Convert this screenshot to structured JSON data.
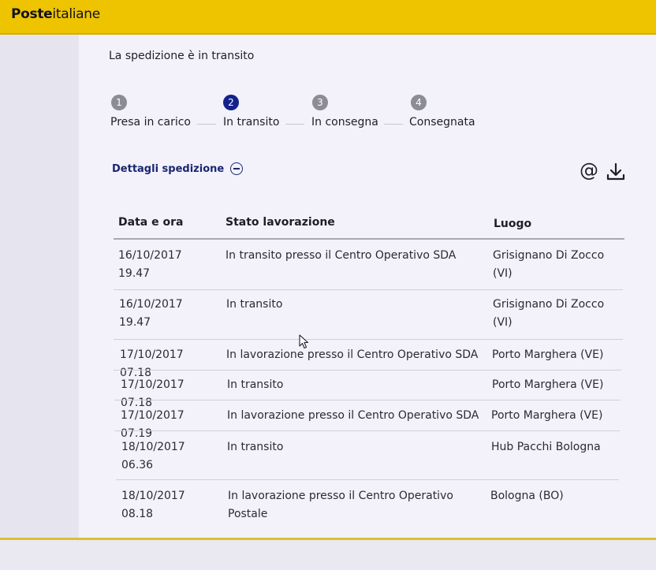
{
  "brand": {
    "bold": "Poste",
    "regular": "italiane"
  },
  "shipment": {
    "status_text": "La spedizione è in transito",
    "steps": [
      {
        "num": "1",
        "label": "Presa in carico",
        "active": false
      },
      {
        "num": "2",
        "label": "In transito",
        "active": true
      },
      {
        "num": "3",
        "label": "In consegna",
        "active": false
      },
      {
        "num": "4",
        "label": "Consegnata",
        "active": false
      }
    ],
    "details_label": "Dettagli spedizione"
  },
  "table": {
    "headers": {
      "date": "Data e ora",
      "status": "Stato lavorazione",
      "place": "Luogo"
    },
    "rows": [
      {
        "date": "16/10/2017 19.47",
        "status": "In transito presso il Centro Operativo SDA",
        "place": "Grisignano Di Zocco (VI)"
      },
      {
        "date": "16/10/2017 19.47",
        "status": "In transito",
        "place": "Grisignano Di Zocco (VI)"
      },
      {
        "date": "17/10/2017 07.18",
        "status": "In lavorazione presso il Centro Operativo SDA",
        "place": "Porto Marghera (VE)"
      },
      {
        "date": "17/10/2017 07.18",
        "status": "In transito",
        "place": "Porto Marghera (VE)"
      },
      {
        "date": "17/10/2017 07.19",
        "status": "In lavorazione presso il Centro Operativo SDA",
        "place": "Porto Marghera (VE)"
      },
      {
        "date": "18/10/2017 06.36",
        "status": "In transito",
        "place": "Hub Pacchi Bologna"
      },
      {
        "date": "18/10/2017 08.18",
        "status": "In lavorazione presso il Centro Operativo Postale",
        "place": "Bologna (BO)"
      }
    ]
  },
  "icons": {
    "email": "at-icon",
    "download": "download-icon"
  },
  "colors": {
    "brand_yellow": "#eec400",
    "active_step": "#14228b",
    "link": "#1a2670"
  }
}
